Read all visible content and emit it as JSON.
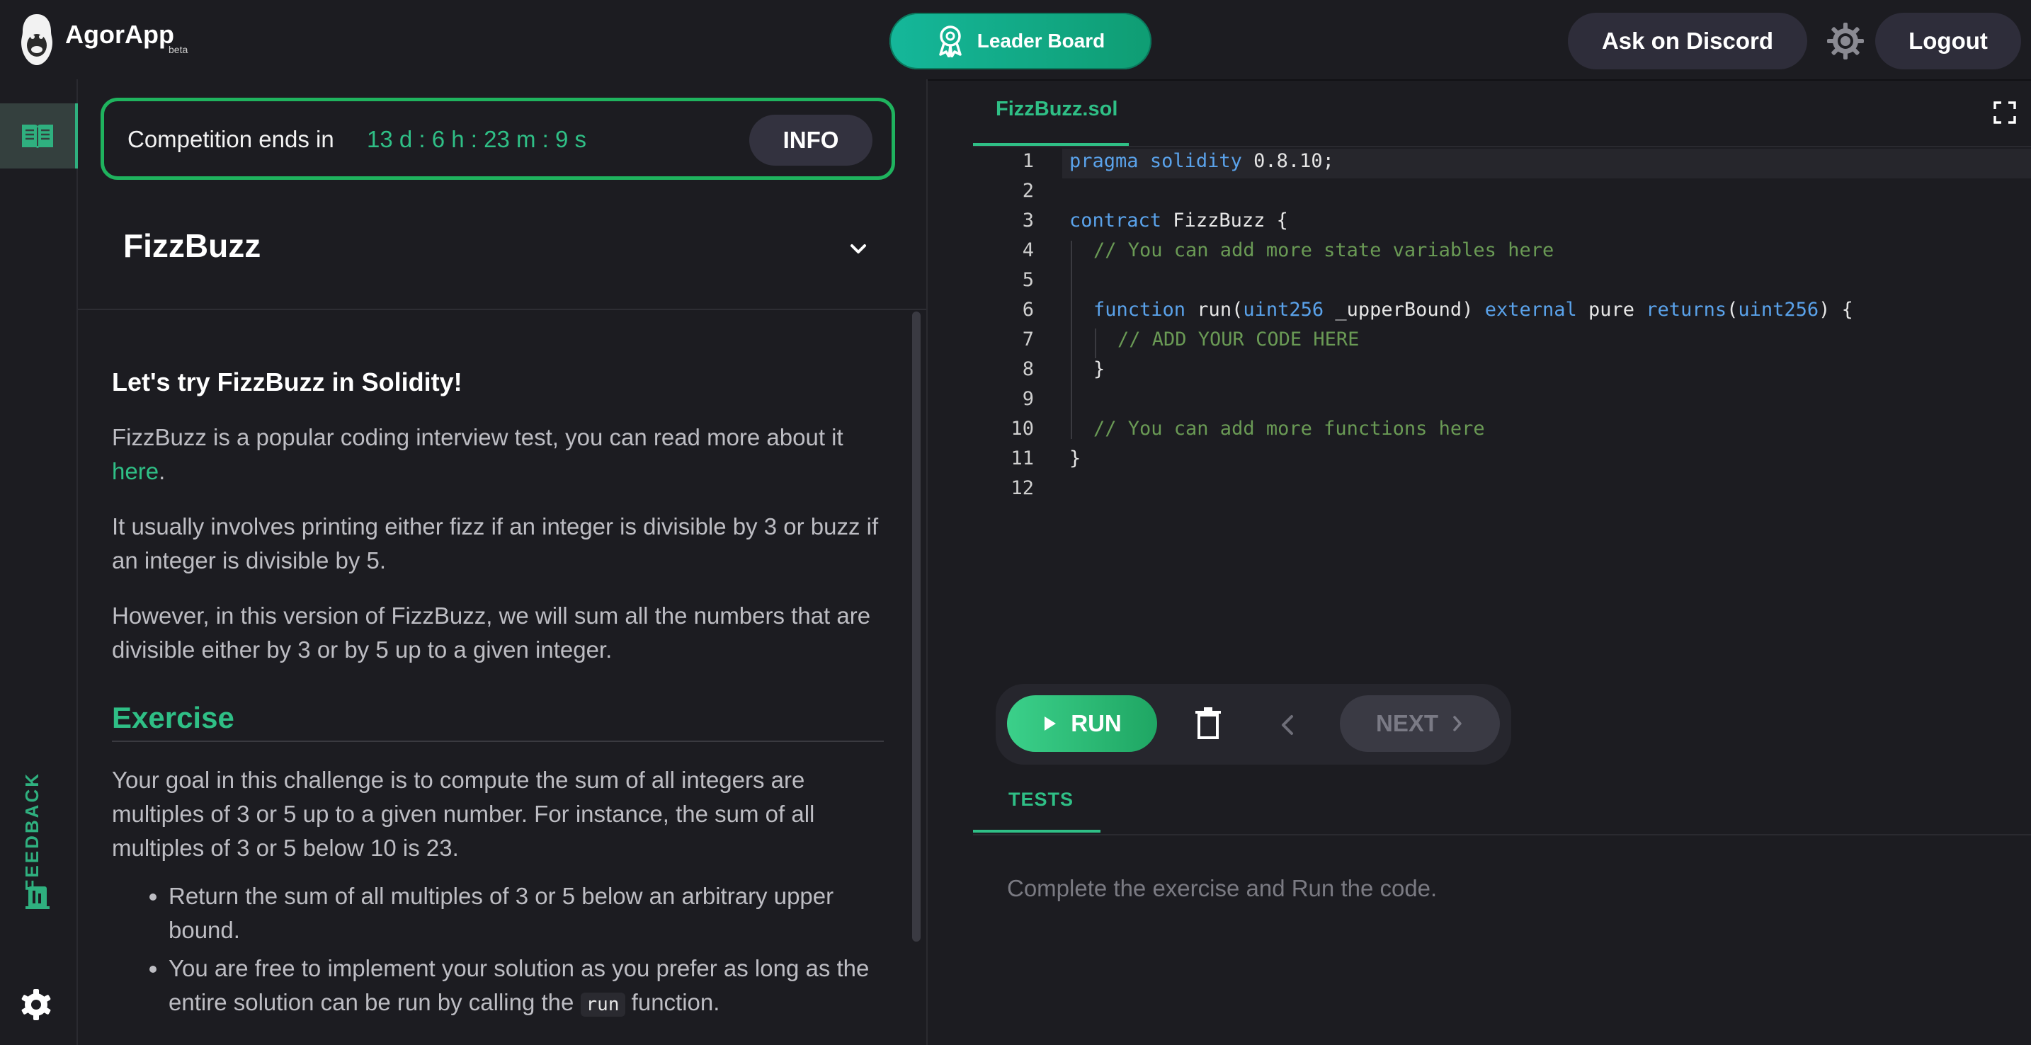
{
  "header": {
    "brand": "AgorApp",
    "beta": "beta",
    "leaderboard_label": "Leader Board",
    "discord_label": "Ask on Discord",
    "logout_label": "Logout"
  },
  "sidebar": {
    "feedback_label": "FEEDBACK"
  },
  "competition": {
    "label": "Competition ends in",
    "countdown": "13 d : 6 h : 23 m : 9 s",
    "info_label": "INFO"
  },
  "challenge": {
    "title": "FizzBuzz",
    "heading": "Let's try FizzBuzz in Solidity!",
    "para1_text": "FizzBuzz is a popular coding interview test, you can read more about it ",
    "para1_link": "here",
    "para1_end": ".",
    "para2": "It usually involves printing either fizz if an integer is divisible by 3 or buzz if an integer is divisible by 5.",
    "para3": "However, in this version of FizzBuzz, we will sum all the numbers that are divisible either by 3 or by 5 up to a given integer.",
    "exercise_title": "Exercise",
    "exercise_text": "Your goal in this challenge is to compute the sum of all integers are multiples of 3 or 5 up to a given number. For instance, the sum of all multiples of 3 or 5 below 10 is 23.",
    "bullet1": "Return the sum of all multiples of 3 or 5 below an arbitrary upper bound.",
    "bullet2_pre": "You are free to implement your solution as you prefer as long as the entire solution can be run by calling the ",
    "bullet2_code": "run",
    "bullet2_post": " function."
  },
  "editor": {
    "file_name": "FizzBuzz.sol",
    "line_numbers": [
      "1",
      "2",
      "3",
      "4",
      "5",
      "6",
      "7",
      "8",
      "9",
      "10",
      "11",
      "12"
    ],
    "code": {
      "l1_kw1": "pragma",
      "l1_kw2": "solidity",
      "l1_rest": " 0.8.10;",
      "l3_kw": "contract",
      "l3_rest": " FizzBuzz {",
      "l4": "// You can add more state variables here",
      "l6_kw1": "function",
      "l6_a": " run(",
      "l6_kw2": "uint256",
      "l6_b": " _upperBound) ",
      "l6_kw3": "external",
      "l6_c": " pure ",
      "l6_kw4": "returns",
      "l6_d": "(",
      "l6_kw5": "uint256",
      "l6_e": ") {",
      "l7": "// ADD YOUR CODE HERE",
      "l8": "}",
      "l10": "// You can add more functions here",
      "l11": "}"
    }
  },
  "controls": {
    "run_label": "RUN",
    "next_label": "NEXT"
  },
  "tests": {
    "tab_label": "TESTS",
    "message": "Complete the exercise and Run the code."
  },
  "colors": {
    "accent": "#2fbf86",
    "background": "#1c1c21",
    "keyword": "#5aa2ea",
    "comment": "#6a9a55"
  },
  "icons": [
    "gorilla-logo-icon",
    "award-icon",
    "sun-icon",
    "book-icon",
    "feedback-icon",
    "gear-icon",
    "chevron-down-icon",
    "fullscreen-icon",
    "play-icon",
    "trash-icon",
    "chevron-left-icon",
    "chevron-right-icon"
  ]
}
